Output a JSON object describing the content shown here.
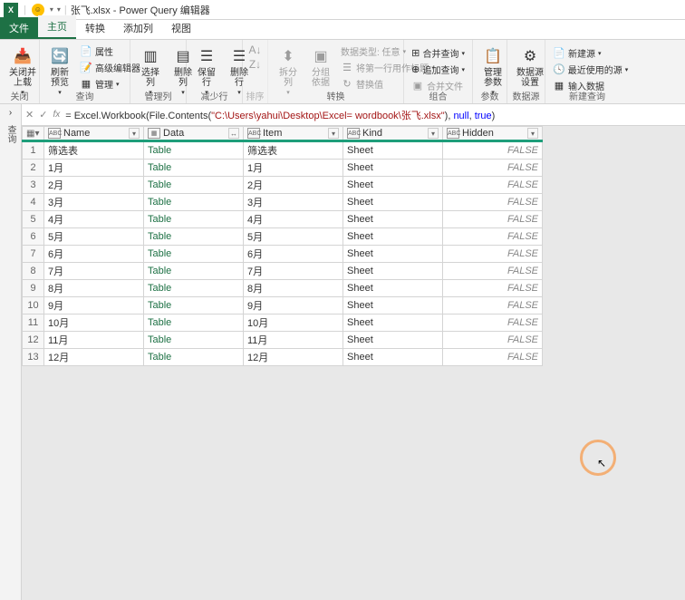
{
  "window": {
    "title": "张飞.xlsx - Power Query 编辑器"
  },
  "tabs": {
    "file": "文件",
    "home": "主页",
    "transform": "转换",
    "add_column": "添加列",
    "view": "视图"
  },
  "ribbon": {
    "groups": {
      "close": {
        "label": "关闭",
        "close_load": "关闭并\n上载"
      },
      "query": {
        "label": "查询",
        "refresh": "刷新\n预览",
        "properties": "属性",
        "advanced_editor": "高级编辑器",
        "manage": "管理"
      },
      "manage_cols": {
        "label": "管理列",
        "choose_cols": "选择\n列",
        "remove_cols": "删除\n列"
      },
      "reduce_rows": {
        "label": "减少行",
        "keep_rows": "保留\n行",
        "remove_rows": "删除\n行"
      },
      "sort": {
        "label": "排序"
      },
      "transform": {
        "label": "转换",
        "split_col": "拆分\n列",
        "group_by": "分组\n依据",
        "data_type": "数据类型: 任意",
        "first_row_header": "将第一行用作标题",
        "replace_values": "替换值"
      },
      "combine": {
        "label": "组合",
        "merge": "合并查询",
        "append": "追加查询",
        "combine_files": "合并文件"
      },
      "params": {
        "label": "参数",
        "manage_params": "管理\n参数"
      },
      "data_source": {
        "label": "数据源",
        "settings": "数据源\n设置"
      },
      "new_query": {
        "label": "新建查询",
        "new_source": "新建源",
        "recent_sources": "最近使用的源",
        "enter_data": "输入数据"
      }
    }
  },
  "formula": {
    "prefix": "= Excel.Workbook(File.Contents(",
    "path": "\"C:\\Users\\yahui\\Desktop\\Excel= wordbook\\张飞.xlsx\"",
    "mid": "), ",
    "null": "null",
    "comma": ", ",
    "true": "true",
    "suffix": ")"
  },
  "side_panel": {
    "label": "查询"
  },
  "columns": {
    "name": "Name",
    "data": "Data",
    "item": "Item",
    "kind": "Kind",
    "hidden": "Hidden"
  },
  "rows": [
    {
      "n": "1",
      "name": "筛选表",
      "data": "Table",
      "item": "筛选表",
      "kind": "Sheet",
      "hidden": "FALSE"
    },
    {
      "n": "2",
      "name": "1月",
      "data": "Table",
      "item": "1月",
      "kind": "Sheet",
      "hidden": "FALSE"
    },
    {
      "n": "3",
      "name": "2月",
      "data": "Table",
      "item": "2月",
      "kind": "Sheet",
      "hidden": "FALSE"
    },
    {
      "n": "4",
      "name": "3月",
      "data": "Table",
      "item": "3月",
      "kind": "Sheet",
      "hidden": "FALSE"
    },
    {
      "n": "5",
      "name": "4月",
      "data": "Table",
      "item": "4月",
      "kind": "Sheet",
      "hidden": "FALSE"
    },
    {
      "n": "6",
      "name": "5月",
      "data": "Table",
      "item": "5月",
      "kind": "Sheet",
      "hidden": "FALSE"
    },
    {
      "n": "7",
      "name": "6月",
      "data": "Table",
      "item": "6月",
      "kind": "Sheet",
      "hidden": "FALSE"
    },
    {
      "n": "8",
      "name": "7月",
      "data": "Table",
      "item": "7月",
      "kind": "Sheet",
      "hidden": "FALSE"
    },
    {
      "n": "9",
      "name": "8月",
      "data": "Table",
      "item": "8月",
      "kind": "Sheet",
      "hidden": "FALSE"
    },
    {
      "n": "10",
      "name": "9月",
      "data": "Table",
      "item": "9月",
      "kind": "Sheet",
      "hidden": "FALSE"
    },
    {
      "n": "11",
      "name": "10月",
      "data": "Table",
      "item": "10月",
      "kind": "Sheet",
      "hidden": "FALSE"
    },
    {
      "n": "12",
      "name": "11月",
      "data": "Table",
      "item": "11月",
      "kind": "Sheet",
      "hidden": "FALSE"
    },
    {
      "n": "13",
      "name": "12月",
      "data": "Table",
      "item": "12月",
      "kind": "Sheet",
      "hidden": "FALSE"
    }
  ]
}
